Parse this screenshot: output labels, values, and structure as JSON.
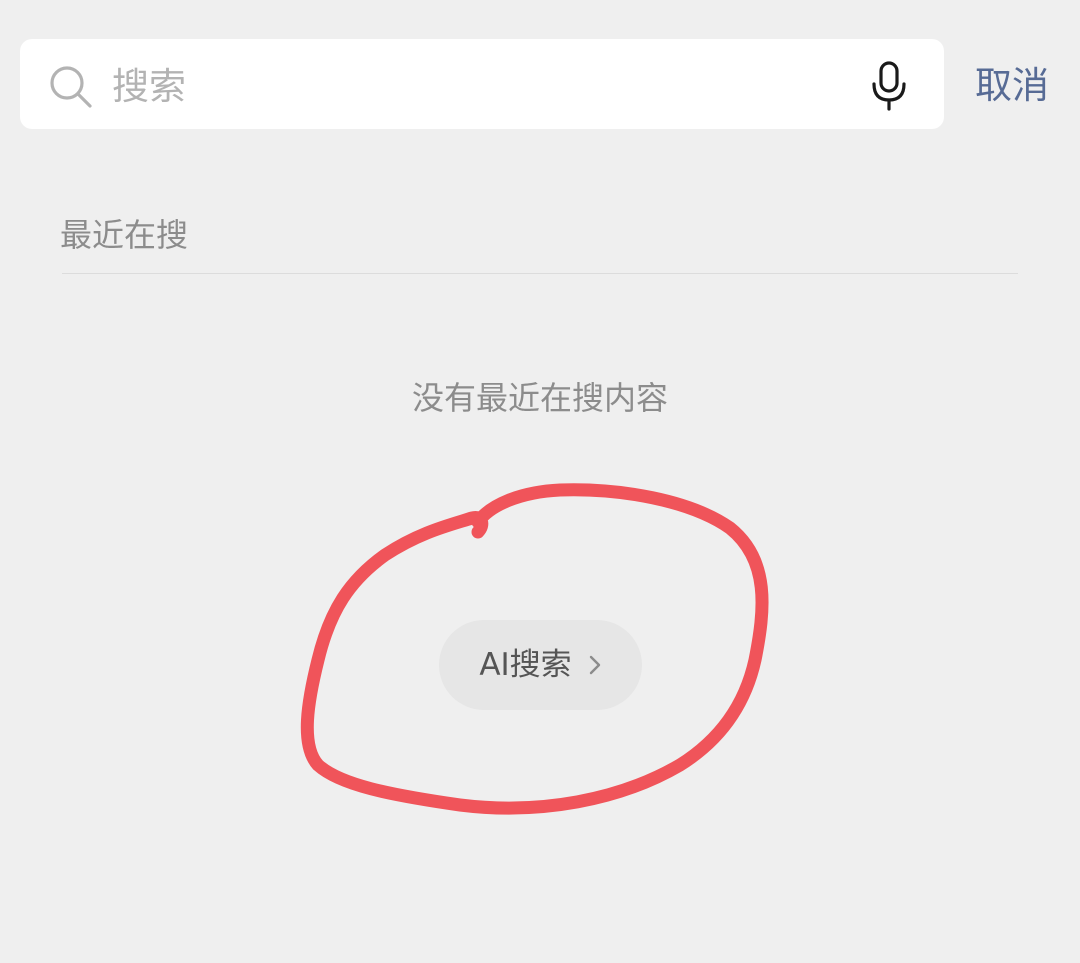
{
  "search": {
    "placeholder": "搜索",
    "value": "",
    "cancel_label": "取消"
  },
  "recent": {
    "title": "最近在搜",
    "empty_text": "没有最近在搜内容"
  },
  "ai_search": {
    "label": "AI搜索"
  },
  "icons": {
    "search": "search-icon",
    "mic": "microphone-icon",
    "chevron": "chevron-right-icon"
  },
  "colors": {
    "background": "#efefef",
    "cancel": "#576b95",
    "annotation": "#f0545a"
  }
}
